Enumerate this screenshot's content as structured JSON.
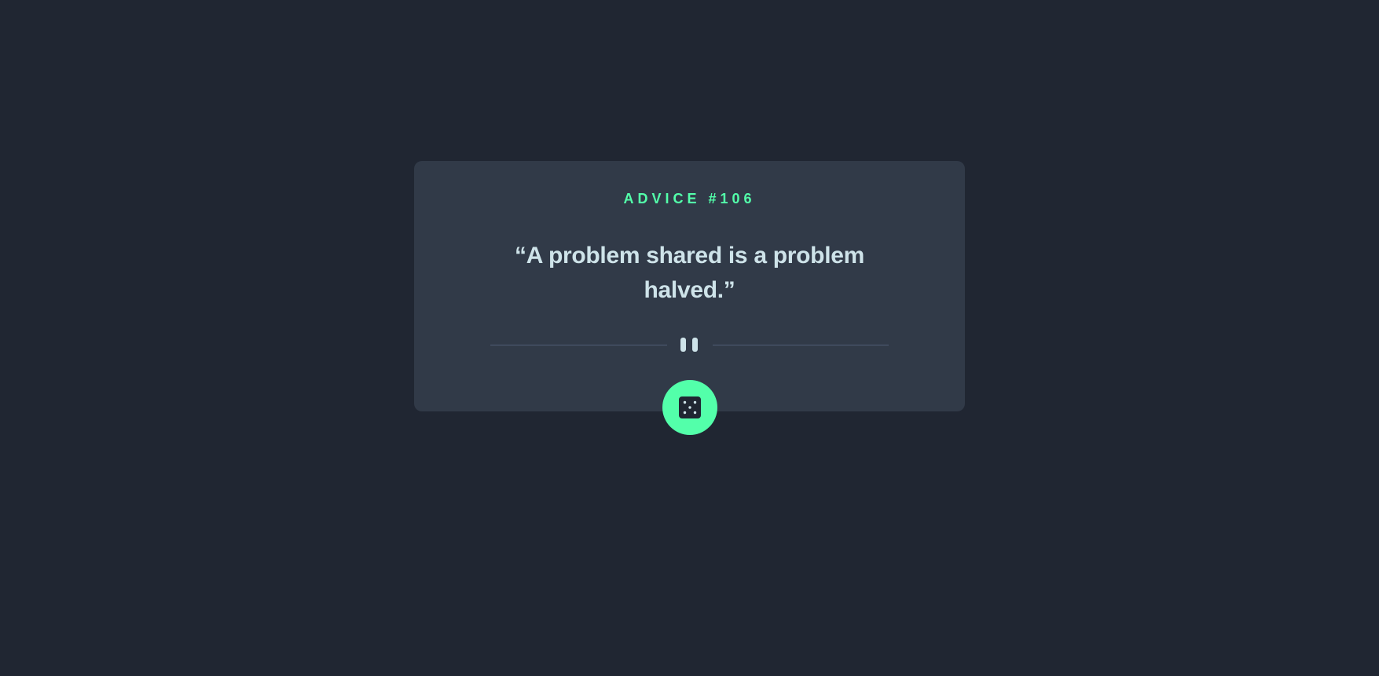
{
  "advice": {
    "label": "ADVICE #106",
    "quote": "“A problem shared is a problem halved.”"
  },
  "divider": {
    "icon": "pause-icon"
  },
  "actions": {
    "dice_icon": "dice-icon"
  },
  "colors": {
    "background": "#202632",
    "card": "#313a48",
    "accent": "#53ffaa",
    "text": "#cee3e9",
    "line": "#4f5d74"
  }
}
